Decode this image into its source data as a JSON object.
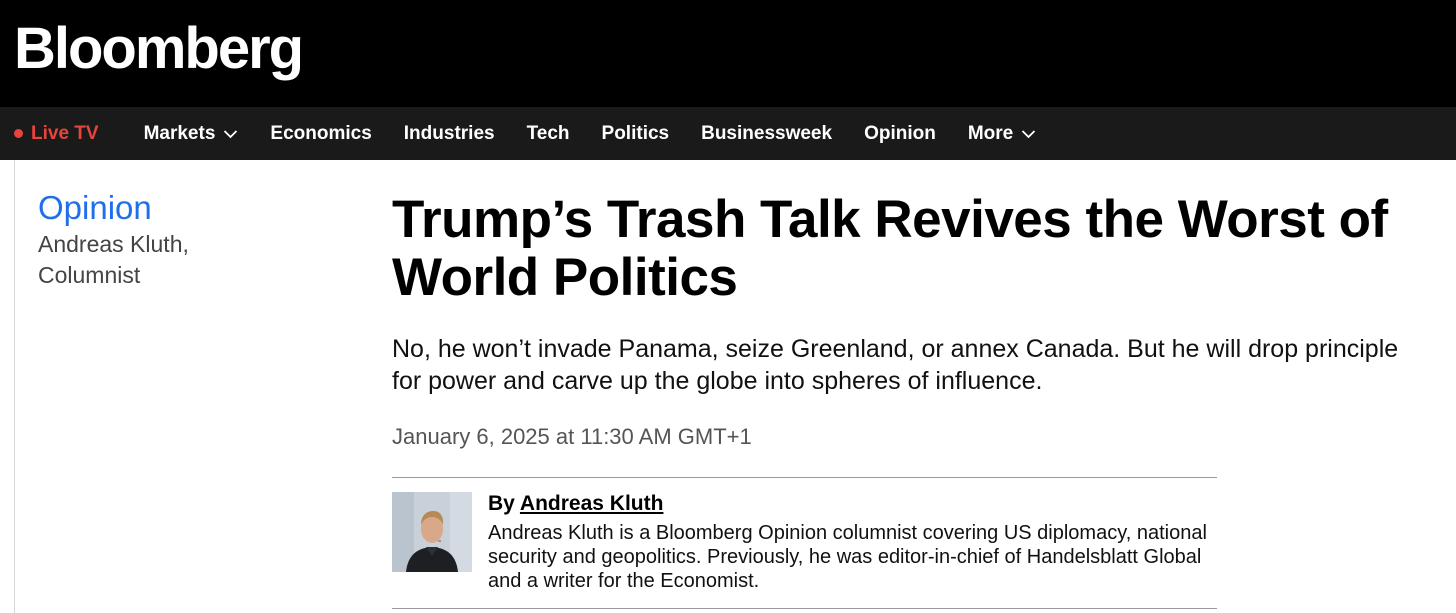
{
  "brand": {
    "logo": "Bloomberg"
  },
  "nav": {
    "live": "Live TV",
    "items": [
      {
        "label": "Markets",
        "dropdown": true
      },
      {
        "label": "Economics"
      },
      {
        "label": "Industries"
      },
      {
        "label": "Tech"
      },
      {
        "label": "Politics"
      },
      {
        "label": "Businessweek"
      },
      {
        "label": "Opinion"
      },
      {
        "label": "More",
        "dropdown": true
      }
    ]
  },
  "sidebar": {
    "section": "Opinion",
    "author_line1": "Andreas Kluth,",
    "author_line2": "Columnist"
  },
  "article": {
    "headline": "Trump’s Trash Talk Revives the Worst of World Politics",
    "dek": "No, he won’t invade Panama, seize Greenland, or annex Canada. But he will drop principle for power and carve up the globe into spheres of influence.",
    "timestamp": "January 6, 2025 at 11:30 AM GMT+1"
  },
  "byline": {
    "prefix": "By",
    "author": "Andreas Kluth",
    "bio": "Andreas Kluth is a Bloomberg Opinion columnist covering US diplomacy, national security and geopolitics. Previously, he was editor-in-chief of Handelsblatt Global and a writer for the Economist."
  },
  "colors": {
    "masthead": "#000000",
    "navbar": "#1a1a1a",
    "live": "#e8433d",
    "section_link": "#1f6feb"
  }
}
